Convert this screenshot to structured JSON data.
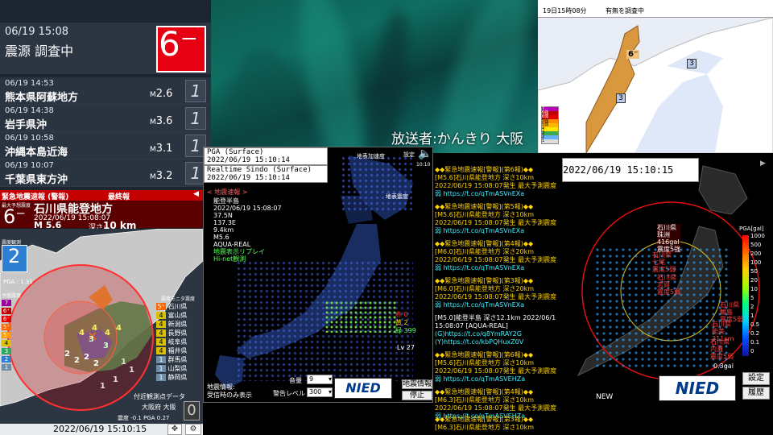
{
  "broadcaster": "放送者:かんきり 大阪",
  "latest": {
    "datetime": "06/19 15:08",
    "place": "震源 調査中",
    "intensity": "6⁻"
  },
  "history": [
    {
      "datetime": "06/19 14:53",
      "place": "熊本県阿蘇地方",
      "mag_prefix": "M",
      "mag": "2.6",
      "intensity": "1"
    },
    {
      "datetime": "06/19 14:38",
      "place": "岩手県沖",
      "mag_prefix": "M",
      "mag": "3.6",
      "intensity": "1"
    },
    {
      "datetime": "06/19 10:58",
      "place": "沖縄本島近海",
      "mag_prefix": "M",
      "mag": "3.1",
      "intensity": "1"
    },
    {
      "datetime": "06/19 10:07",
      "place": "千葉県東方沖",
      "mag_prefix": "M",
      "mag": "3.2",
      "intensity": "1"
    }
  ],
  "eew": {
    "title": "緊急地震速報 (警報)",
    "final": "最終報",
    "max_label": "最大予想震度",
    "max_int": "6⁻",
    "region": "石川県能登地方",
    "datetime": "2022/06/19 15:08:07",
    "mag": "M 5.6",
    "depth_label": "深さ:",
    "depth": "10 km",
    "observed_label": "震度観測",
    "observed_int": "2",
    "pga": "PGA : 1.31",
    "forecast_label": "予想震度",
    "legend": [
      "7",
      "6⁺",
      "6⁻",
      "5⁺",
      "5⁻",
      "4",
      "3",
      "2",
      "1"
    ],
    "monitor_label": "震度モニタ震度",
    "prefs": [
      {
        "int": "5⁺",
        "name": "石川県"
      },
      {
        "int": "4",
        "name": "富山県"
      },
      {
        "int": "4",
        "name": "新潟県"
      },
      {
        "int": "4",
        "name": "長野県"
      },
      {
        "int": "4",
        "name": "岐阜県"
      },
      {
        "int": "4",
        "name": "福井県"
      },
      {
        "int": "1",
        "name": "群馬県"
      },
      {
        "int": "1",
        "name": "山梨県"
      },
      {
        "int": "1",
        "name": "静岡県"
      }
    ],
    "nearby_label": "付近観測点データ",
    "nearby_station": "大阪府 大阪",
    "nearby_int": "0",
    "nearby_vals": "震度 -0.1  PGA 0.27",
    "clock": "2022/06/19 15:10:15",
    "map_labels": [
      "2",
      "2",
      "2",
      "2",
      "3",
      "3",
      "4",
      "4",
      "4",
      "4",
      "1",
      "1",
      "1",
      "1"
    ]
  },
  "center": {
    "pga_label": "PGA (Surface)",
    "pga_time": "2022/06/19 15:10:14",
    "rt_label": "Realtime Sindo (Surface)",
    "rt_time": "2022/06/19 15:10:14",
    "eew_tag": "< 地震速報 >",
    "quake": [
      "能登半島",
      "2022/06/19 15:08:07",
      "37.5N",
      "137.3E",
      "9.4km",
      "M5.6",
      "AQUA-REAL"
    ],
    "green_lines": [
      "地震表示リプレイ",
      "Hi-net観測"
    ],
    "surface_label": "地表加速度",
    "settings": "設定",
    "clock_small": "10:10",
    "surface_int": "地表震度",
    "counts": {
      "red": "赤 0",
      "yellow": "黄 2",
      "green": "緑 399"
    },
    "lv": "Lv 27",
    "quake_info": "地震情報:",
    "quake_info2": "受信時のみ表示",
    "volume_label": "音量",
    "volume": "9",
    "alert_label": "警告レベル",
    "alert": "300",
    "nied": "NIED",
    "btn_info": "地震情報",
    "btn_stop": "停止"
  },
  "tweets": [
    {
      "head": "◆◆緊急地震速報[警報](第6報)◆◆",
      "l1": "[M5.6]石川県能登地方 深さ10km",
      "l2": "2022/06/19 15:08:07発生 最大予測震度",
      "link": "弱 https://t.co/qTmASVnEXa"
    },
    {
      "head": "◆◆緊急地震速報[警報](第5報)◆◆",
      "l1": "[M5.6]石川県能登地方 深さ10km",
      "l2": "2022/06/19 15:08:07発生 最大予測震度",
      "link": "弱 https://t.co/qTmASVnEXa"
    },
    {
      "head": "◆◆緊急地震速報[警報](第4報)◆◆",
      "l1": "[M6.0]石川県能登地方 深さ20km",
      "l2": "2022/06/19 15:08:07発生 最大予測震度",
      "link": "弱 https://t.co/qTmASVnEXa"
    },
    {
      "head": "◆◆緊急地震速報[警報](第3報)◆◆",
      "l1": "[M6.0]石川県能登地方 深さ20km",
      "l2": "2022/06/19 15:08:07発生 最大予測震度",
      "link": "弱 https://t.co/qTmASVnEXa"
    },
    {
      "head": "[M5.0]能登半島 深さ12.1km 2022/06/1",
      "l1": "15:08:07 [AQUA-REAL]",
      "l2": "(G)https://t.co/q8YmRAY2G",
      "link": "(Y)https://t.co/kbPQHuxZ0V"
    },
    {
      "head": "◆◆緊急地震速報[警報](第6報)◆◆",
      "l1": "[M5.6]石川県能登地方 深さ10km",
      "l2": "2022/06/19 15:08:07発生 最大予測震度",
      "link": "弱 https://t.co/qTmASVEHZa"
    },
    {
      "head": "◆◆緊急地震速報[警報](第4報)◆◆",
      "l1": "[M6.3]石川県能登地方 深さ10km",
      "l2": "2022/06/19 15:08:07発生 最大予測震度",
      "link": "弱 https://t.co/qTmASVEHZa"
    },
    {
      "head": "◆◆緊急地震速報[警報](第3報)◆◆",
      "l1": "[M6.3]石川県能登地方 深さ10km",
      "l2": "",
      "link": ""
    }
  ],
  "pga": {
    "time": "2022/06/19 15:10:15",
    "unit": "PGA[gal]",
    "scale": [
      "1000",
      "500",
      "200",
      "100",
      "50",
      "20",
      "10",
      "5",
      "2",
      "1",
      "0.5",
      "0.2",
      "0.1",
      "0"
    ],
    "callouts": [
      "石川県",
      "珠洲",
      "416gal",
      "震度5強",
      "石川県",
      "七尾",
      "震度5弱",
      "石川県",
      "志賀",
      "震度5弱",
      "石川県",
      "内灘",
      "震度5弱",
      "石川県",
      "輪島",
      "震度5弱",
      "石川県",
      "能美",
      "311cm"
    ],
    "gal": "0.3gal",
    "new": "NEW",
    "nied": "NIED",
    "btn_settings": "設定",
    "btn_history": "履歴"
  },
  "rmap": {
    "time": "19日15時08分",
    "status": "有無を調査中",
    "pin": "6⁻",
    "n3a": "3",
    "n3b": "3",
    "legend": [
      "7",
      "6強",
      "6弱",
      "5強",
      "5弱",
      "4",
      "3",
      "2",
      "1"
    ]
  }
}
